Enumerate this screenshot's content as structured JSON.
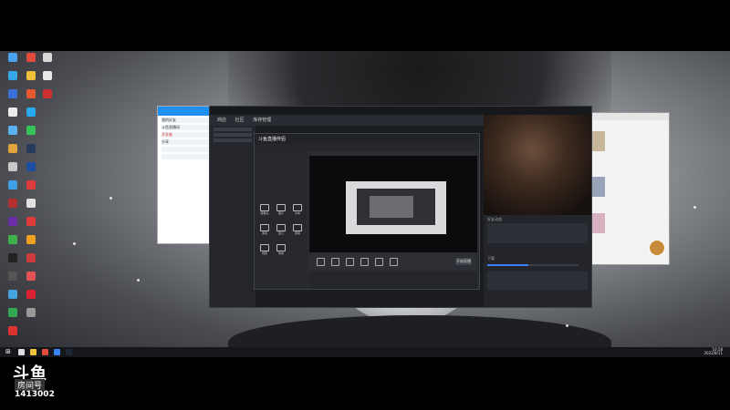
{
  "colors": {
    "accent": "#1f8ff2",
    "steam_blue": "#3b82f6",
    "dark": "#1f2127"
  },
  "watermark": {
    "logo": "斗鱼",
    "sub": "房间号",
    "room_id": "1413002"
  },
  "main_window": {
    "menu": [
      "商店",
      "社区",
      "库存管理"
    ],
    "panel_section_1": "好友动态",
    "panel_section_2": "下载"
  },
  "obs": {
    "logo": "斗鱼直播伴侣",
    "start_label": "开始直播",
    "tools": [
      "摄像头",
      "图片",
      "文本",
      "游戏",
      "窗口",
      "屏幕",
      "视频",
      "特效"
    ]
  },
  "chat_window": {
    "rows": [
      "我的好友",
      "斗鱼直播间",
      "开发者",
      "分享"
    ]
  },
  "icons": {
    "start": "windows-start-icon"
  },
  "taskbar": {
    "time": "10:58",
    "date": "2022/8/11"
  }
}
